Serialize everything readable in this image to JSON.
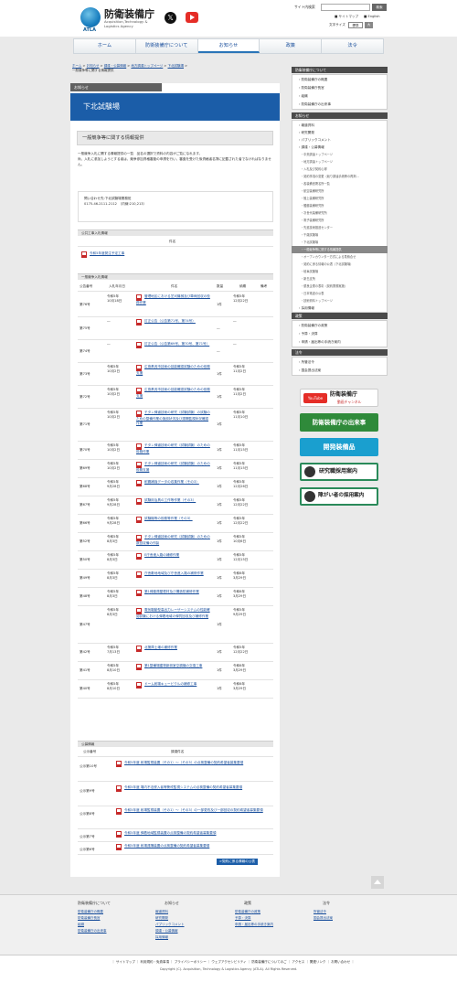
{
  "header": {
    "logo_text": "防衛装備庁",
    "logo_en": "Acquisition,Technology & Logistics Agency",
    "logo_atla": "ATLA",
    "search_label": "サイト内検索",
    "search_button": "検索",
    "sitemap": "サイトマップ",
    "english": "English",
    "fontsize_label": "文字サイズ",
    "fontsize_std": "標準",
    "fontsize_large": "大"
  },
  "gnav": [
    "ホーム",
    "防衛装備庁について",
    "お知らせ",
    "政策",
    "法令"
  ],
  "breadcrumb": [
    "ホーム",
    "お知らせ",
    "調達・公募情報",
    "地方調達トップページ",
    "下北試験場",
    "一般競争等に関する情報提供"
  ],
  "main": {
    "section_tag": "お知らせ",
    "page_title": "下北試験場",
    "subtitle": "一般競争等に関する情報提供",
    "intro": [
      "一般競争入札に関する情報提供の一覧　品名の選択で資料の内容がご覧になれます。",
      "尚、入札に参加しようとする者は、競争参加資格審査の申請を行い、審査を受けた後資格者名簿に記載された者でなければなりません。"
    ],
    "contact": [
      "問い合わせ先:下北試験場業務班",
      "0175-46-2111-2112　（内線:210,213）"
    ],
    "public_works": {
      "heading": "公共工事入札情報",
      "col_name": "件名",
      "items": [
        "令和5年度発注予定工事"
      ]
    },
    "bids": {
      "heading": "一般競争入札情報",
      "cols": [
        "公告番号",
        "入札年月日",
        "件名",
        "数量",
        "納期",
        "備考"
      ],
      "rows": [
        {
          "no": "第76号",
          "date": "令和5年\n10月18日",
          "name": "管理地区における芝刈機械及び車両回収の役務作業",
          "qty": "1件",
          "due": "令和5年\n12月22日"
        },
        {
          "no": "第75号",
          "date": "―",
          "name": "訂正公告（公告第71号、第74号）",
          "qty": "―",
          "due": "―"
        },
        {
          "no": "第74号",
          "date": "―",
          "name": "訂正公告（公告第69号、第70号、第71号）",
          "qty": "―",
          "due": "―"
        },
        {
          "no": "第73号",
          "date": "令和5年\n10月2日",
          "name": "広島県呉市技術の技能確認試験のための役務支援",
          "qty": "1件",
          "due": "令和5年\n11月2日"
        },
        {
          "no": "第72号",
          "date": "令和5年\n10月2日",
          "name": "広島県呉市技術の技能確認試験のための役務支援",
          "qty": "1件",
          "due": "令和5年\n11月2日"
        },
        {
          "no": "第71号",
          "date": "令和5年\n10月2日",
          "name": "チタン弾道技術の研究（試験試験）の試験のための整備作業の施設状況及び遠隔監視状況確認作業",
          "qty": "1件",
          "due": "令和5年\n11月10日"
        },
        {
          "no": "第70号",
          "date": "令和5年\n10月2日",
          "name": "チタン弾道技術の研究（試験試験）のための役務作業",
          "qty": "1件",
          "due": "令和5年\n11月15日"
        },
        {
          "no": "第69号",
          "date": "令和5年\n10月2日",
          "name": "チタン弾道技術の研究（試験試験）のための役務支援",
          "qty": "1件",
          "due": "令和5年\n11月15日"
        },
        {
          "no": "第68号",
          "date": "令和5年\n9月28日",
          "name": "耐震補強データの収集作業（その3）",
          "qty": "1件",
          "due": "令和5年\n12月26日"
        },
        {
          "no": "第67号",
          "date": "令和5年\n9月28日",
          "name": "試験用治具の工作等作業（その3）",
          "qty": "1件",
          "due": "令和5年\n12月22日"
        },
        {
          "no": "第66号",
          "date": "令和5年\n9月28日",
          "name": "試験機等の役務等作業（その3）",
          "qty": "1件",
          "due": "令和5年\n12月22日"
        },
        {
          "no": "第52号",
          "date": "令和5年\n8月3日",
          "name": "チタン弾道技術の研究（試験試験）のための数回収備の作製",
          "qty": "1件",
          "due": "令和5年\n10月6日"
        },
        {
          "no": "第50号",
          "date": "令和5年\n8月3日",
          "name": "E庁舎進入路の補修作業",
          "qty": "1件",
          "due": "令和5年\n12月15日"
        },
        {
          "no": "第49号",
          "date": "令和5年\n8月3日",
          "name": "庁舎敷地地域及び庁舎進入路の補修作業",
          "qty": "1件",
          "due": "令和6年\n3月29日"
        },
        {
          "no": "第48号",
          "date": "令和5年\n8月3日",
          "name": "第1弾薬庫屋根材及び構造防補修作業",
          "qty": "1件",
          "due": "令和6年\n3月29日"
        },
        {
          "no": "第47号",
          "date": "令和5年\n8月3日",
          "name": "電気駆動型高出力レーザーシステムの性能確認試験における弾着地域の弾質回収及び補修作業",
          "qty": "1件",
          "due": "令和5年\n9月29日"
        },
        {
          "no": "第42号",
          "date": "令和5年\n7月13日",
          "name": "北第庫土壌の補修作業",
          "qty": "1件",
          "due": "令和5年\n12月22日"
        },
        {
          "no": "第41号",
          "date": "令和5年\n8月10日",
          "name": "第1整備場建物新設室空調機の交換工事",
          "qty": "1件",
          "due": "令和6年\n3月29日"
        },
        {
          "no": "第40号",
          "date": "令和5年\n8月10日",
          "name": "ドーム射場キュービクルの補修工事",
          "qty": "1件",
          "due": "令和6年\n3月29日"
        }
      ]
    },
    "notices": {
      "heading": "公募情報",
      "cols": [
        "公示番号",
        "調達件名"
      ],
      "rows": [
        {
          "no": "公示第10号",
          "name": "令和5年度 射場監視装置（その1）～（その3）の点検整備の契約希望者募集要領"
        },
        {
          "no": "公示第9号",
          "name": "令和5年度 場内不法侵入者等警戒監視システムの点検整備の契約希望者募集要領"
        },
        {
          "no": "公示第8号",
          "name": "令和5年度 射場監視装置（その1）～（その3）の一部更改及び一部回収の契約希望者募集要領"
        },
        {
          "no": "公示第7号",
          "name": "令和5年度 弾着地域監視装置の点検整備の契約希望者募集要領"
        },
        {
          "no": "公示第6号",
          "name": "令和5年度 射場遠隔装置の点検整備の契約希望者募集要領"
        }
      ],
      "more": ">契約に係る情報の公表"
    }
  },
  "sidebar": {
    "about": {
      "heading": "防衛装備庁について",
      "items": [
        "防衛装備庁の概要",
        "防衛装備庁長官",
        "組織",
        "防衛装備庁の出来事"
      ]
    },
    "news": {
      "heading": "お知らせ",
      "items": [
        {
          "label": "報道資料",
          "sub": false
        },
        {
          "label": "研究開発",
          "sub": false
        },
        {
          "label": "パブリックコメント",
          "sub": false
        },
        {
          "label": "調達・公募情報",
          "sub": false
        },
        {
          "label": "中央調達トップページ",
          "sub": true
        },
        {
          "label": "地方調達トップページ",
          "sub": true
        },
        {
          "label": "入札及び契約心得",
          "sub": true
        },
        {
          "label": "契約事項の変更（競り調達手続等の再掲…",
          "sub": true
        },
        {
          "label": "各装備官署名所一覧",
          "sub": true
        },
        {
          "label": "航空装備研究所",
          "sub": true
        },
        {
          "label": "陸上装備研究所",
          "sub": true
        },
        {
          "label": "艦艇装備研究所",
          "sub": true
        },
        {
          "label": "次世代装備研究所",
          "sub": true
        },
        {
          "label": "電子装備研究所",
          "sub": true
        },
        {
          "label": "先進技術推進センター",
          "sub": true
        },
        {
          "label": "千歳試験場",
          "sub": true
        },
        {
          "label": "下北試験場",
          "sub": true
        },
        {
          "label": "一般競争等に関する情報提供",
          "sub": true,
          "active": true
        },
        {
          "label": "オープンカウンター方式による見積合せ",
          "sub": true
        },
        {
          "label": "契約に係る情報の公表（下北試験場）",
          "sub": true
        },
        {
          "label": "岐阜試験場",
          "sub": true
        },
        {
          "label": "新島支所",
          "sub": true
        },
        {
          "label": "優良企業の表彰（契約業務実施）",
          "sub": true
        },
        {
          "label": "日本電波の公表",
          "sub": true
        },
        {
          "label": "技術資料トップページ",
          "sub": true
        },
        {
          "label": "採用情報",
          "sub": false
        }
      ]
    },
    "policy": {
      "heading": "政策",
      "items": [
        "防衛装備庁の政策",
        "予算・決算",
        "申請・届出等の手続き案内"
      ]
    },
    "law": {
      "heading": "法令",
      "items": [
        "所管法令",
        "国会提出法案"
      ]
    },
    "banners": [
      {
        "label": "防衛装備庁",
        "sub": "動画チャンネル",
        "color": "#ffffff"
      },
      {
        "label": "防衛装備庁の出来事",
        "color": "#2f8a3a"
      },
      {
        "label": "開発装備品",
        "color": "#1a9fcf"
      },
      {
        "label": "研究職採用案内",
        "color": "#ffffff"
      },
      {
        "label": "障がい者の採用案内",
        "color": "#ffffff"
      }
    ]
  },
  "footer": {
    "columns": [
      {
        "heading": "防衛装備庁について",
        "links": [
          "防衛装備庁の概要",
          "防衛装備庁長官",
          "組織",
          "防衛装備庁の出来事"
        ]
      },
      {
        "heading": "お知らせ",
        "links": [
          "報道資料",
          "研究開発",
          "パブリックコメント",
          "調達・公募情報",
          "採用情報"
        ]
      },
      {
        "heading": "政策",
        "links": [
          "防衛装備庁の政策",
          "予算・決算",
          "申請・届出等の手続き案内"
        ]
      },
      {
        "heading": "法令",
        "links": [
          "所管法令",
          "国会提出法案"
        ]
      }
    ],
    "nav": "｜ サイトマップ ｜ 利用規約・免責事項 ｜ プライバシーポリシー ｜ ウェブアクセシビリティ ｜ 防衛装備庁についてのご ｜ アクセス ｜ 関連リンク ｜ お問い合わせ ｜",
    "copyright": "Copyright (C). Acquisition, Technology & Logistics Agency (ATLA). All Rights Reserved."
  }
}
